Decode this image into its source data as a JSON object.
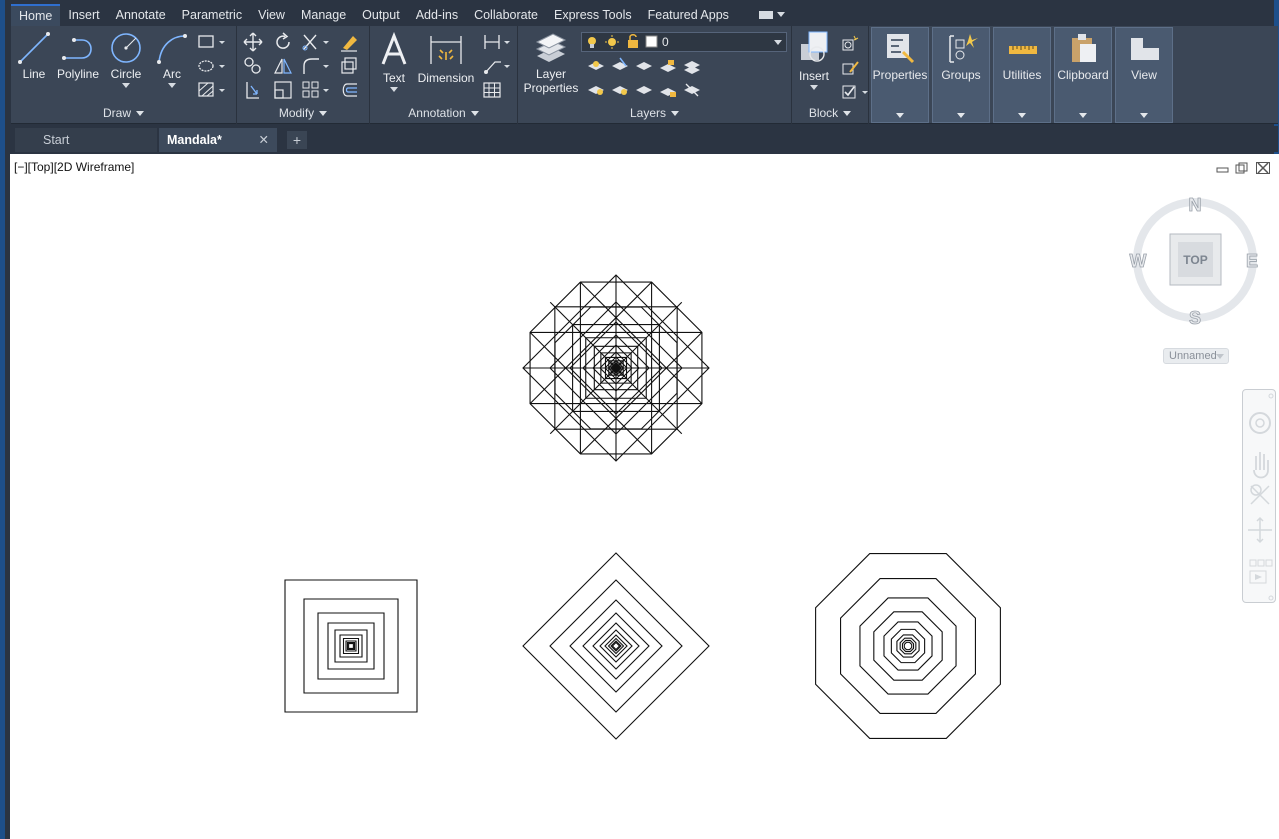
{
  "menu": {
    "tabs": [
      "Home",
      "Insert",
      "Annotate",
      "Parametric",
      "View",
      "Manage",
      "Output",
      "Add-ins",
      "Collaborate",
      "Express Tools",
      "Featured Apps"
    ],
    "active": "Home"
  },
  "ribbon": {
    "draw": {
      "title": "Draw",
      "line": "Line",
      "polyline": "Polyline",
      "circle": "Circle",
      "arc": "Arc"
    },
    "modify": {
      "title": "Modify"
    },
    "annotation": {
      "title": "Annotation",
      "text": "Text",
      "dimension": "Dimension"
    },
    "layers": {
      "title": "Layers",
      "layer_properties_line1": "Layer",
      "layer_properties_line2": "Properties",
      "current_layer": "0"
    },
    "block": {
      "title": "Block",
      "insert": "Insert"
    },
    "properties": "Properties",
    "groups": "Groups",
    "utilities": "Utilities",
    "clipboard": "Clipboard",
    "view": "View"
  },
  "doc_tabs": {
    "start": "Start",
    "active": "Mandala*",
    "close": "✕",
    "add": "+"
  },
  "viewport": {
    "label": "[−][Top][2D Wireframe]",
    "viewcube": {
      "north": "N",
      "south": "S",
      "east": "E",
      "west": "W",
      "face": "TOP"
    },
    "ucs": "Unnamed"
  }
}
